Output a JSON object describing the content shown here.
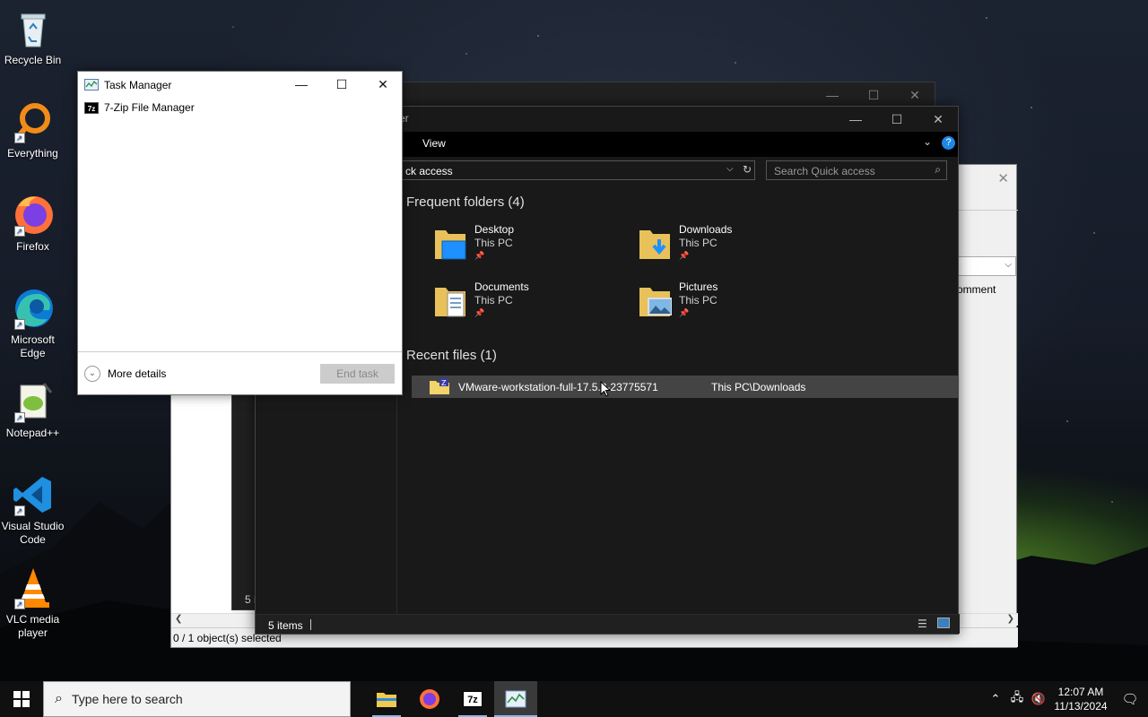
{
  "desktop_icons": [
    {
      "label": "Recycle Bin",
      "icon": "recycle-bin-icon"
    },
    {
      "label": "Everything",
      "icon": "everything-icon"
    },
    {
      "label": "Firefox",
      "icon": "firefox-icon"
    },
    {
      "label": "Microsoft Edge",
      "icon": "edge-icon"
    },
    {
      "label": "Notepad++",
      "icon": "notepadpp-icon"
    },
    {
      "label": "Visual Studio Code",
      "icon": "vscode-icon"
    },
    {
      "label": "VLC media player",
      "icon": "vlc-icon"
    }
  ],
  "task_manager": {
    "title": "Task Manager",
    "apps": [
      "7-Zip File Manager"
    ],
    "more_details": "More details",
    "end_task": "End task"
  },
  "explorer": {
    "title_fragment": "er",
    "ribbon_tab": "View",
    "address": "ck access",
    "search_placeholder": "Search Quick access",
    "frequent_header": "Frequent folders (4)",
    "folders": [
      {
        "name": "Desktop",
        "location": "This PC",
        "icon": "desktop-folder-icon"
      },
      {
        "name": "Downloads",
        "location": "This PC",
        "icon": "downloads-folder-icon"
      },
      {
        "name": "Documents",
        "location": "This PC",
        "icon": "documents-folder-icon"
      },
      {
        "name": "Pictures",
        "location": "This PC",
        "icon": "pictures-folder-icon"
      }
    ],
    "recent_header": "Recent files (1)",
    "recent_files": [
      {
        "name": "VMware-workstation-full-17.5.2-23775571",
        "path": "This PC\\Downloads"
      }
    ],
    "status_items": "5 items",
    "back_status_fragment": "5 i"
  },
  "zip_manager": {
    "column_fragment": "omment",
    "status": "0 / 1 object(s) selected"
  },
  "taskbar": {
    "search_placeholder": "Type here to search",
    "time": "12:07 AM",
    "date": "11/13/2024"
  },
  "colors": {
    "accent": "#0078d7",
    "help": "#1e88e5",
    "selection": "#444444"
  }
}
